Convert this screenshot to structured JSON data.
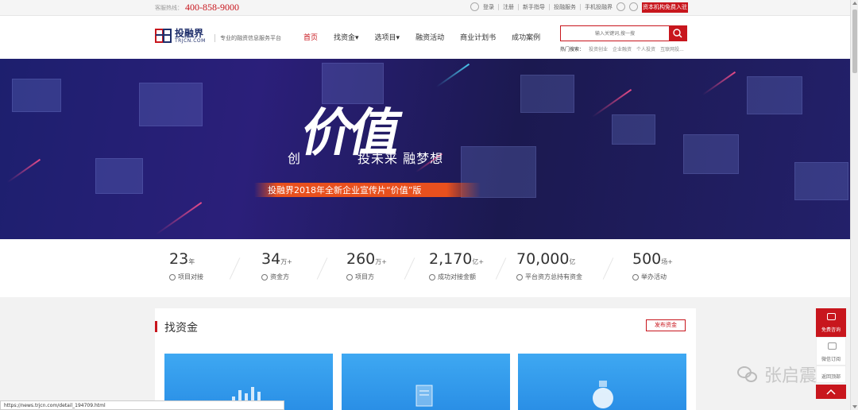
{
  "topbar": {
    "hotline_label": "客服热线：",
    "hotline": "400-858-9000",
    "links": [
      "登录",
      "注册",
      "新手指导",
      "投融服务",
      "手机投融界"
    ],
    "enter_button": "资本机构免费入驻"
  },
  "header": {
    "logo_cn": "投融界",
    "logo_en": "TRJCN.COM",
    "tagline": "专业的融资信息服务平台",
    "nav": [
      "首页",
      "找资金▾",
      "选项目▾",
      "融资活动",
      "商业计划书",
      "成功案例"
    ],
    "search_placeholder": "输入关键词,搜一搜",
    "hot_label": "热门搜索：",
    "hot_items": [
      "投资创业",
      "企业融资",
      "个人投资",
      "互联网投..."
    ]
  },
  "banner": {
    "chuang": "创",
    "jiazhi": "价值",
    "slogan": "投未来  融梦想",
    "ribbon": "投融界2018年全新企业宣传片“价值”版"
  },
  "stats": [
    {
      "num": "23",
      "unit": "年",
      "label": "项目对接"
    },
    {
      "num": "34",
      "unit": "万+",
      "label": "资金方"
    },
    {
      "num": "260",
      "unit": "万+",
      "label": "项目方"
    },
    {
      "num": "2,170",
      "unit": "亿+",
      "label": "成功对接金额"
    },
    {
      "num": "70,000",
      "unit": "亿",
      "label": "平台资方总持有资金"
    },
    {
      "num": "500",
      "unit": "场+",
      "label": "举办活动"
    }
  ],
  "section": {
    "title": "找资金",
    "publish": "发布资金"
  },
  "float": {
    "consult": "免费咨询",
    "wechat": "微信订阅",
    "top": "返回顶部"
  },
  "watermark": "张启震",
  "statusbar": "https://news.trjcn.com/detail_194709.html"
}
